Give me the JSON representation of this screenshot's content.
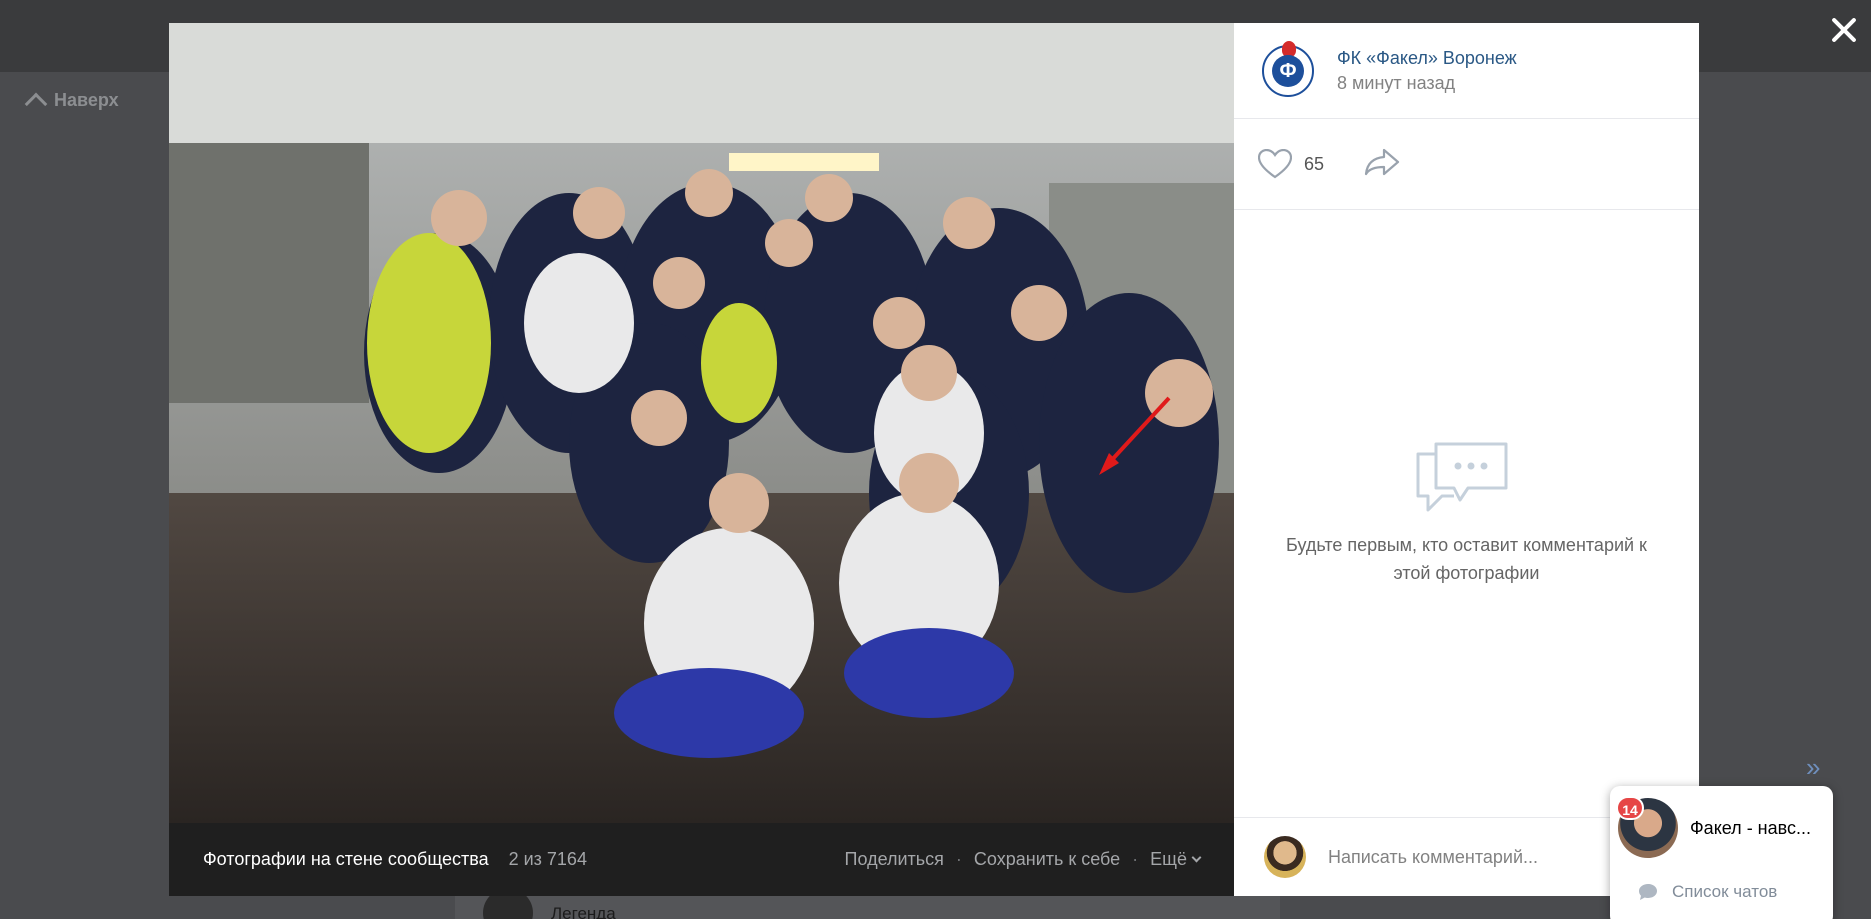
{
  "background": {
    "up_label": "Наверх",
    "feed_text": "Легенда"
  },
  "viewer": {
    "footer": {
      "album": "Фотографии на стене сообщества",
      "counter": "2 из 7164",
      "share": "Поделиться",
      "separator": "·",
      "save": "Сохранить к себе",
      "more": "Ещё"
    },
    "info": {
      "club_name": "ФК «Факел» Воронеж",
      "time": "8 минут назад",
      "likes": "65",
      "empty_comments": "Будьте первым, кто оставит комментарий к этой фотографии",
      "comment_placeholder": "Написать комментарий..."
    }
  },
  "chat_widget": {
    "badge": "14",
    "chat_name": "Факел - навс...",
    "chat_list": "Список чатов"
  },
  "colors": {
    "link": "#2a5885",
    "badge": "#e64646",
    "footer_bg": "#1f1f1f"
  }
}
